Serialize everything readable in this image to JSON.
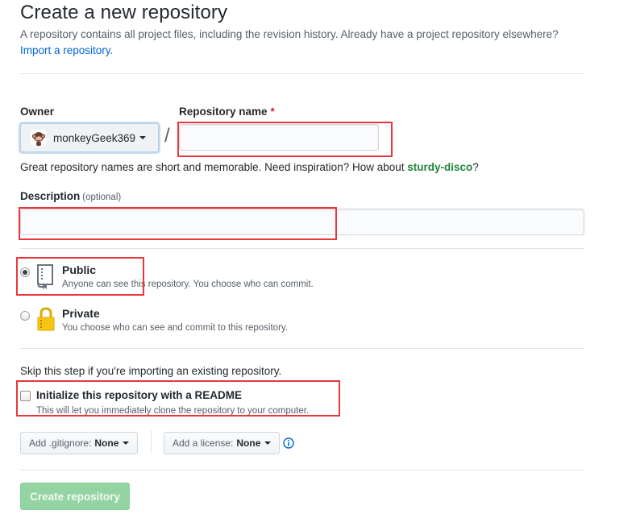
{
  "header": {
    "title": "Create a new repository",
    "subtitle": "A repository contains all project files, including the revision history. Already have a project repository elsewhere?",
    "import_link": "Import a repository."
  },
  "owner": {
    "label": "Owner",
    "value": "monkeyGeek369",
    "avatar_icon": "monkey-avatar"
  },
  "repo_name": {
    "label": "Repository name",
    "required_marker": "*",
    "separator": "/",
    "value": "",
    "hint_prefix": "Great repository names are short and memorable. Need inspiration? How about ",
    "hint_suggestion": "sturdy-disco",
    "hint_suffix": "?"
  },
  "description": {
    "label": "Description",
    "optional": "(optional)",
    "value": ""
  },
  "visibility": {
    "public": {
      "label": "Public",
      "note": "Anyone can see this repository. You choose who can commit.",
      "icon": "repo-book-icon",
      "selected": true
    },
    "private": {
      "label": "Private",
      "note": "You choose who can see and commit to this repository.",
      "icon": "lock-icon",
      "selected": false
    }
  },
  "init": {
    "skip_note": "Skip this step if you're importing an existing repository.",
    "readme_label": "Initialize this repository with a README",
    "readme_note": "This will let you immediately clone the repository to your computer.",
    "readme_checked": false
  },
  "gitignore": {
    "label": "Add .gitignore:",
    "value": "None"
  },
  "license": {
    "label": "Add a license:",
    "value": "None"
  },
  "submit": {
    "label": "Create repository"
  },
  "colors": {
    "link": "#0366d6",
    "suggestion": "#22863a",
    "required": "#cb2431",
    "annotation_box": "#e8383d",
    "submit_disabled_bg": "#94d3a2"
  }
}
